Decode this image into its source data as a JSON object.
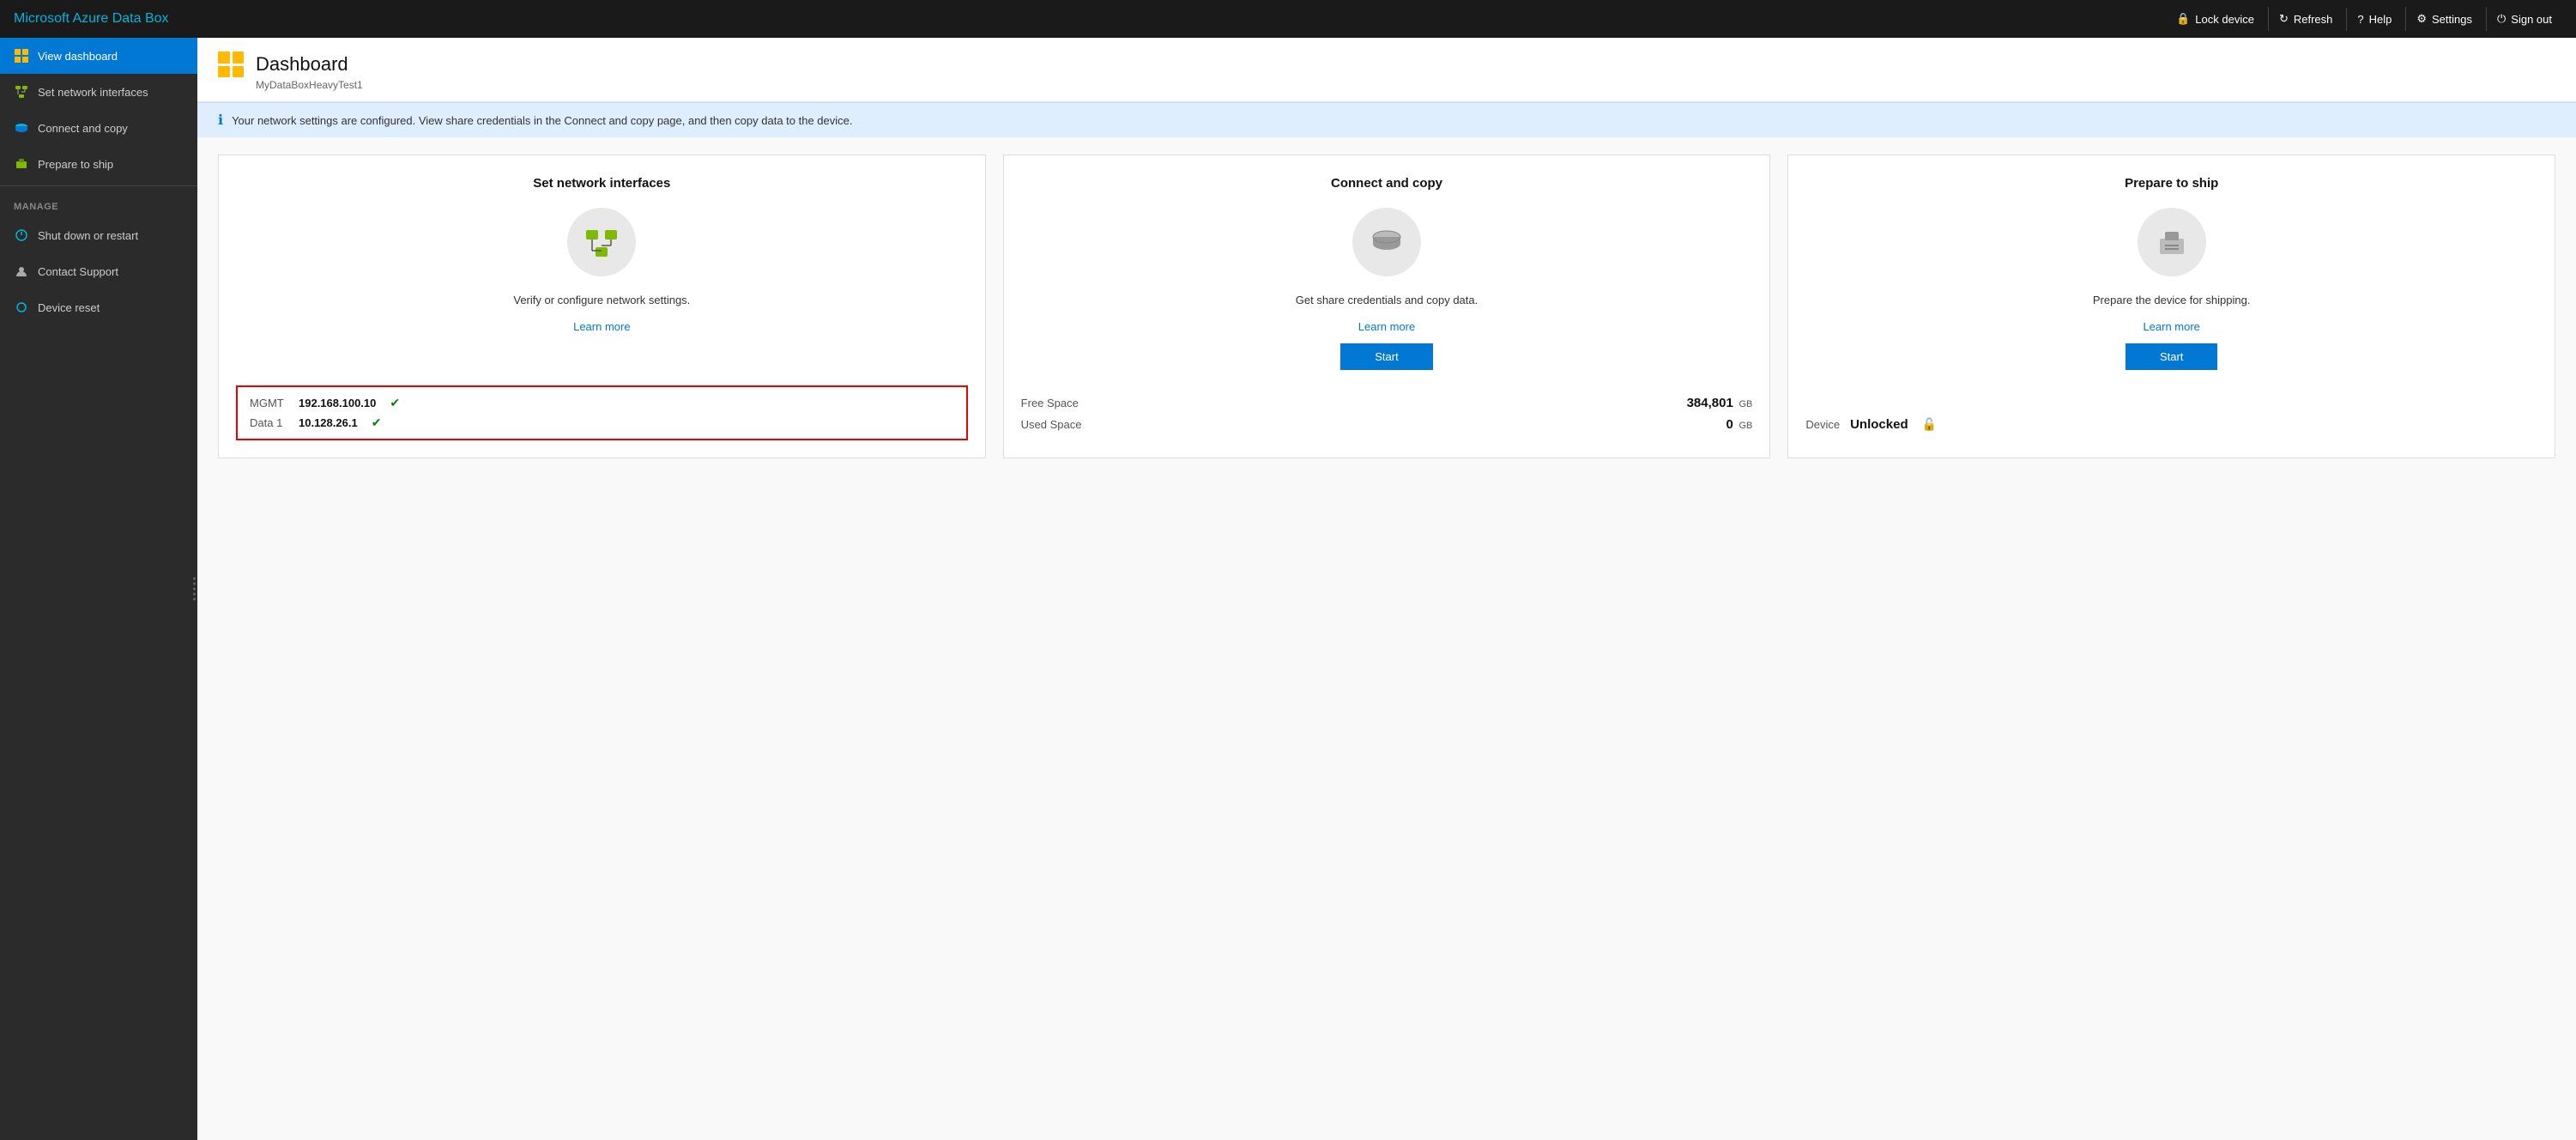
{
  "brand": "Microsoft Azure Data Box",
  "topNav": {
    "lockLabel": "Lock device",
    "refreshLabel": "Refresh",
    "helpLabel": "Help",
    "settingsLabel": "Settings",
    "signOutLabel": "Sign out"
  },
  "sidebar": {
    "mainItems": [
      {
        "id": "view-dashboard",
        "label": "View dashboard",
        "active": true
      },
      {
        "id": "set-network",
        "label": "Set network interfaces",
        "active": false
      },
      {
        "id": "connect-copy",
        "label": "Connect and copy",
        "active": false
      },
      {
        "id": "prepare-ship",
        "label": "Prepare to ship",
        "active": false
      }
    ],
    "sectionLabel": "MANAGE",
    "manageItems": [
      {
        "id": "shutdown",
        "label": "Shut down or restart"
      },
      {
        "id": "contact-support",
        "label": "Contact Support"
      },
      {
        "id": "device-reset",
        "label": "Device reset"
      }
    ]
  },
  "page": {
    "title": "Dashboard",
    "subtitle": "MyDataBoxHeavyTest1"
  },
  "infoBanner": "Your network settings are configured. View share credentials in the Connect and copy page, and then copy data to the device.",
  "cards": [
    {
      "id": "network-card",
      "title": "Set network interfaces",
      "description": "Verify or configure network settings.",
      "learnMore": "Learn more",
      "footer": {
        "type": "network",
        "rows": [
          {
            "label": "MGMT",
            "value": "192.168.100.10",
            "checked": true
          },
          {
            "label": "Data 1",
            "value": "10.128.26.1",
            "checked": true
          }
        ]
      }
    },
    {
      "id": "copy-card",
      "title": "Connect and copy",
      "description": "Get share credentials and copy data.",
      "learnMore": "Learn more",
      "startLabel": "Start",
      "footer": {
        "type": "stats",
        "stats": [
          {
            "label": "Free Space",
            "value": "384,801",
            "unit": "GB"
          },
          {
            "label": "Used Space",
            "value": "0",
            "unit": "GB"
          }
        ]
      }
    },
    {
      "id": "ship-card",
      "title": "Prepare to ship",
      "description": "Prepare the device for shipping.",
      "learnMore": "Learn more",
      "startLabel": "Start",
      "footer": {
        "type": "device",
        "label": "Device",
        "value": "Unlocked"
      }
    }
  ]
}
